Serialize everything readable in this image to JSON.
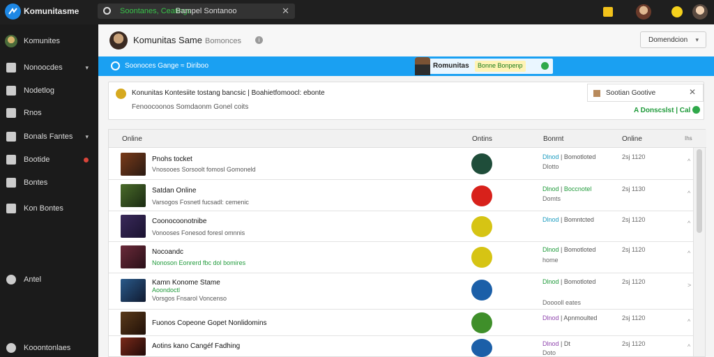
{
  "app": {
    "title": "Komunitasme"
  },
  "search": {
    "value_green": "Soontanes, Ceatings",
    "value_white": "Bampel Sontanoo"
  },
  "sidebar": {
    "items": [
      {
        "label": "Komunites",
        "name": "sidebar-item-komunites"
      },
      {
        "label": "Nonoocdes",
        "name": "sidebar-item-nonoocdes"
      },
      {
        "label": "Nodetlog",
        "name": "sidebar-item-nodetlog"
      },
      {
        "label": "Rnos",
        "name": "sidebar-item-rnos"
      },
      {
        "label": "Bonals Fantes",
        "name": "sidebar-item-bonals-fantes"
      },
      {
        "label": "Bootide",
        "name": "sidebar-item-bootide"
      },
      {
        "label": "Bontes",
        "name": "sidebar-item-bontes"
      },
      {
        "label": "Kon Bontes",
        "name": "sidebar-item-kon-bontes"
      },
      {
        "label": "Antel",
        "name": "sidebar-item-antel"
      },
      {
        "label": "Kooontonlaes",
        "name": "sidebar-item-kooontonlaes"
      }
    ]
  },
  "header": {
    "title": "Komunitas Same",
    "subtitle": "Bomonces",
    "dropdown": "Domendcion"
  },
  "banner": {
    "text": "Soonoces Gange ≈ Diriboo",
    "pill_name": "Romunitas",
    "pill_tag": "Bonne Bonpenp"
  },
  "notice": {
    "line1": "Konunitas Kontesiite tostang bancsic | Boahietfomoocl: ebonte",
    "line2": "Fenoocoonos Somdaonm Gonel coits",
    "side_label": "Sootian Gootive",
    "online": "A Donscslst | Cal"
  },
  "table": {
    "headers": {
      "name": "Online",
      "status": "Ontins",
      "sources": "Bonrnt",
      "time": "Online",
      "actions": "Ihs"
    },
    "rows": [
      {
        "title": "Pnohs tocket",
        "subtitle": "",
        "desc": "Vnosooes Sorsoolt fomosl Gomoneld",
        "desc_green": false,
        "status_color": "#1f4d3a",
        "s1a": "Dlnod",
        "s1b": "Bomotloted",
        "s1a_cls": "b",
        "s2": "Dlotto",
        "time": "2sj 1120",
        "act": "^"
      },
      {
        "title": "Satdan Online",
        "subtitle": "",
        "desc": "Varsogos Fosnetl fucsadl: cemenic",
        "desc_green": false,
        "status_color": "#d8211b",
        "s1a": "Dlnod",
        "s1b": "Boccnotel",
        "s1a_cls": "g",
        "s2": "Domts",
        "time": "2sj 1130",
        "act": "^"
      },
      {
        "title": "Coonocoonotnibe",
        "subtitle": "",
        "desc": "Vonooses Fonesod foresl omnnis",
        "desc_green": false,
        "status_color": "#d6c414",
        "s1a": "Dlnod",
        "s1b": "Bomntcted",
        "s1a_cls": "b",
        "s2": "",
        "time": "2sj 1120",
        "act": "^"
      },
      {
        "title": "Nocoandc",
        "subtitle": "",
        "desc": "Nonoson Eonrerd fbc dol bomires",
        "desc_green": true,
        "status_color": "#d6c414",
        "s1a": "Dlnod",
        "s1b": "Bomotloted",
        "s1a_cls": "g",
        "s2": "home",
        "time": "2sj 1120",
        "act": "^"
      },
      {
        "title": "Kamn Konome Stame",
        "subtitle": "Aoondoctl",
        "desc": "Vorsgos Fnsarol Voncenso",
        "desc_green": false,
        "status_color": "#1b5fa8",
        "s1a": "Dlnod",
        "s1b": "Bomotloted",
        "s1a_cls": "g",
        "s2": "Dooooll eates",
        "time": "2sj 1120",
        "act": ">"
      },
      {
        "title": "Fuonos Copeone Gopet Nonlidomins",
        "subtitle": "",
        "desc": "",
        "desc_green": false,
        "status_color": "#3f8f2a",
        "s1a": "Dlnod",
        "s1b": "Apnmoulted",
        "s1a_cls": "p",
        "s2": "",
        "time": "2sj 1120",
        "act": "^"
      },
      {
        "title": "Aotins kano Cangéf Fadhing",
        "subtitle": "",
        "desc": "",
        "desc_green": false,
        "status_color": "#1b5fa8",
        "s1a": "Dlnod",
        "s1b": "Dt",
        "s1a_cls": "p",
        "s2": "Doto",
        "time": "2sj 1120",
        "act": "^"
      }
    ]
  }
}
